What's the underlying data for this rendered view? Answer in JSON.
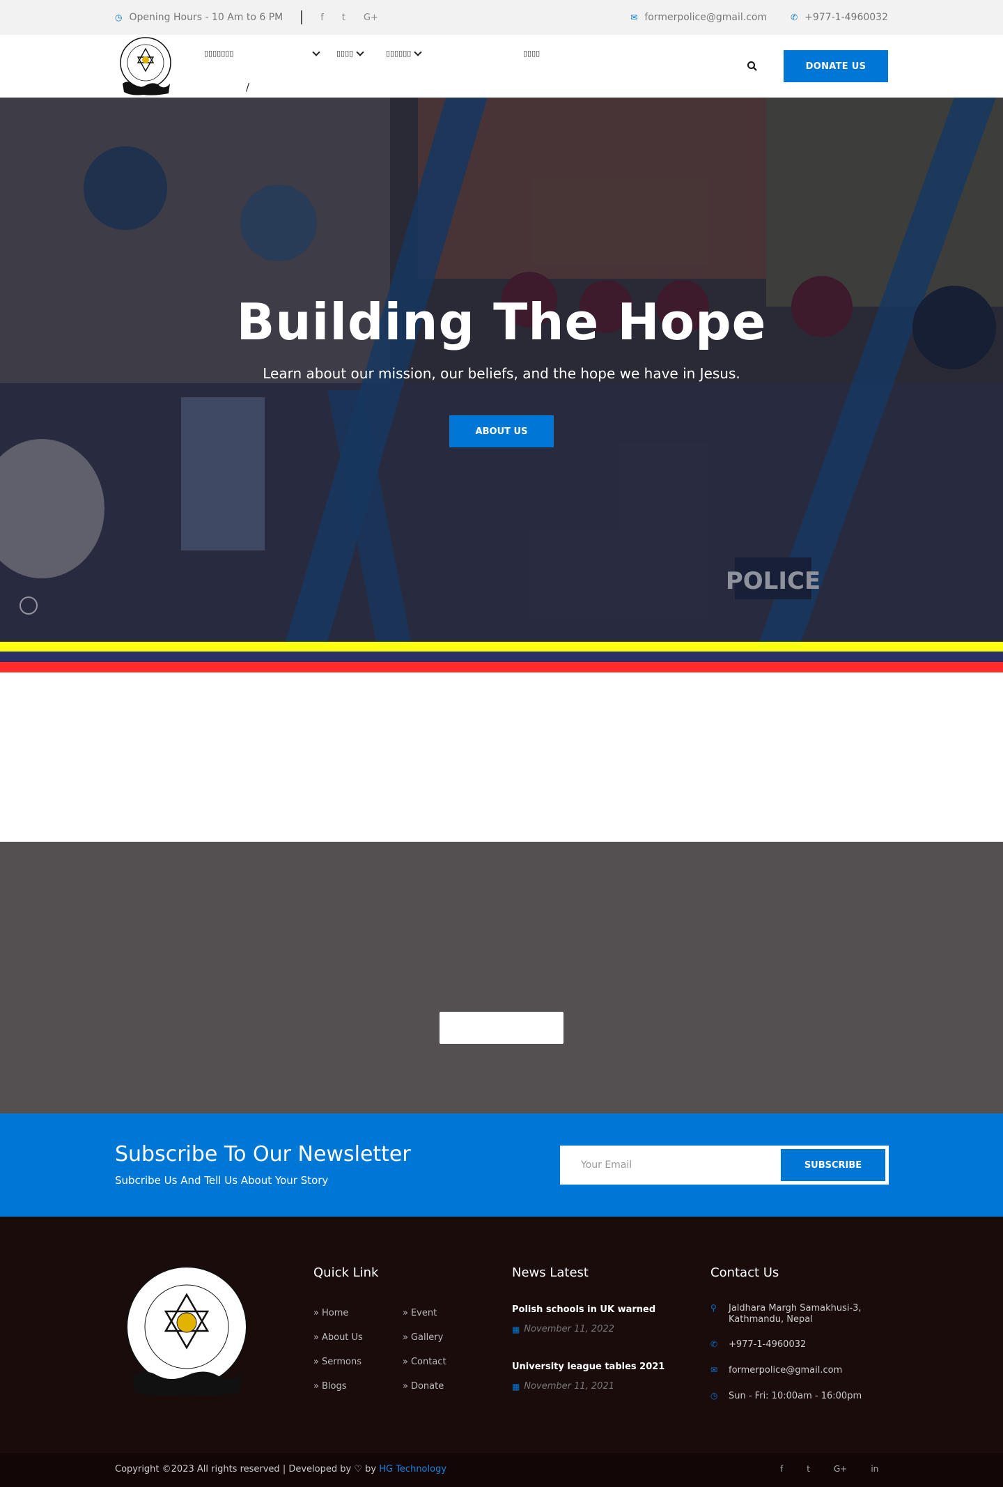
{
  "topbar": {
    "hours": "Opening Hours - 10 Am to 6 PM",
    "social": [
      "f",
      "t",
      "G+"
    ],
    "email": "formerpolice@gmail.com",
    "phone": "+977-1-4960032"
  },
  "nav": {
    "menu": [
      {
        "label": "▯▯▯▯▯▯▯",
        "dropdown": true
      },
      {
        "label": "▯▯▯▯",
        "dropdown": true
      },
      {
        "label": "▯▯▯▯▯▯",
        "dropdown": true
      },
      {
        "label": "▯▯▯▯",
        "dropdown": false
      }
    ],
    "separator": "/",
    "donate_label": "DONATE US"
  },
  "hero": {
    "title": "Building The Hope",
    "subtitle": "Learn about our mission, our beliefs, and the hope we have in Jesus.",
    "button_label": "ABOUT US",
    "background_text": "POLICE"
  },
  "stripes": {
    "colors": [
      "#ffff14",
      "#2b3067",
      "#ff2a2a"
    ]
  },
  "newsletter": {
    "title": "Subscribe To Our Newsletter",
    "subtitle": "Subcribe Us And Tell Us About Your Story",
    "placeholder": "Your Email",
    "button_label": "SUBSCRIBE"
  },
  "footer": {
    "quick_link_title": "Quick Link",
    "quick_links_col1": [
      "Home",
      "About Us",
      "Sermons",
      "Blogs"
    ],
    "quick_links_col2": [
      "Event",
      "Gallery",
      "Contact",
      "Donate"
    ],
    "news_title": "News Latest",
    "news": [
      {
        "title": "Polish schools in UK warned",
        "date": "November 11, 2022"
      },
      {
        "title": "University league tables 2021",
        "date": "November 11, 2021"
      }
    ],
    "contact_title": "Contact Us",
    "contact": {
      "address": "Jaldhara Margh Samakhusi-3, Kathmandu, Nepal",
      "phone": "+977-1-4960032",
      "email": "formerpolice@gmail.com",
      "hours": "Sun - Fri: 10:00am - 16:00pm"
    }
  },
  "bottom": {
    "copyright": "Copyright ©2023 All rights reserved | Developed by",
    "by": "by",
    "developer": "HG Technology",
    "social": [
      "f",
      "t",
      "G+",
      "in"
    ]
  },
  "colors": {
    "accent": "#0077d5",
    "footer_bg": "#1b0c0c",
    "gray_section": "#545051"
  }
}
